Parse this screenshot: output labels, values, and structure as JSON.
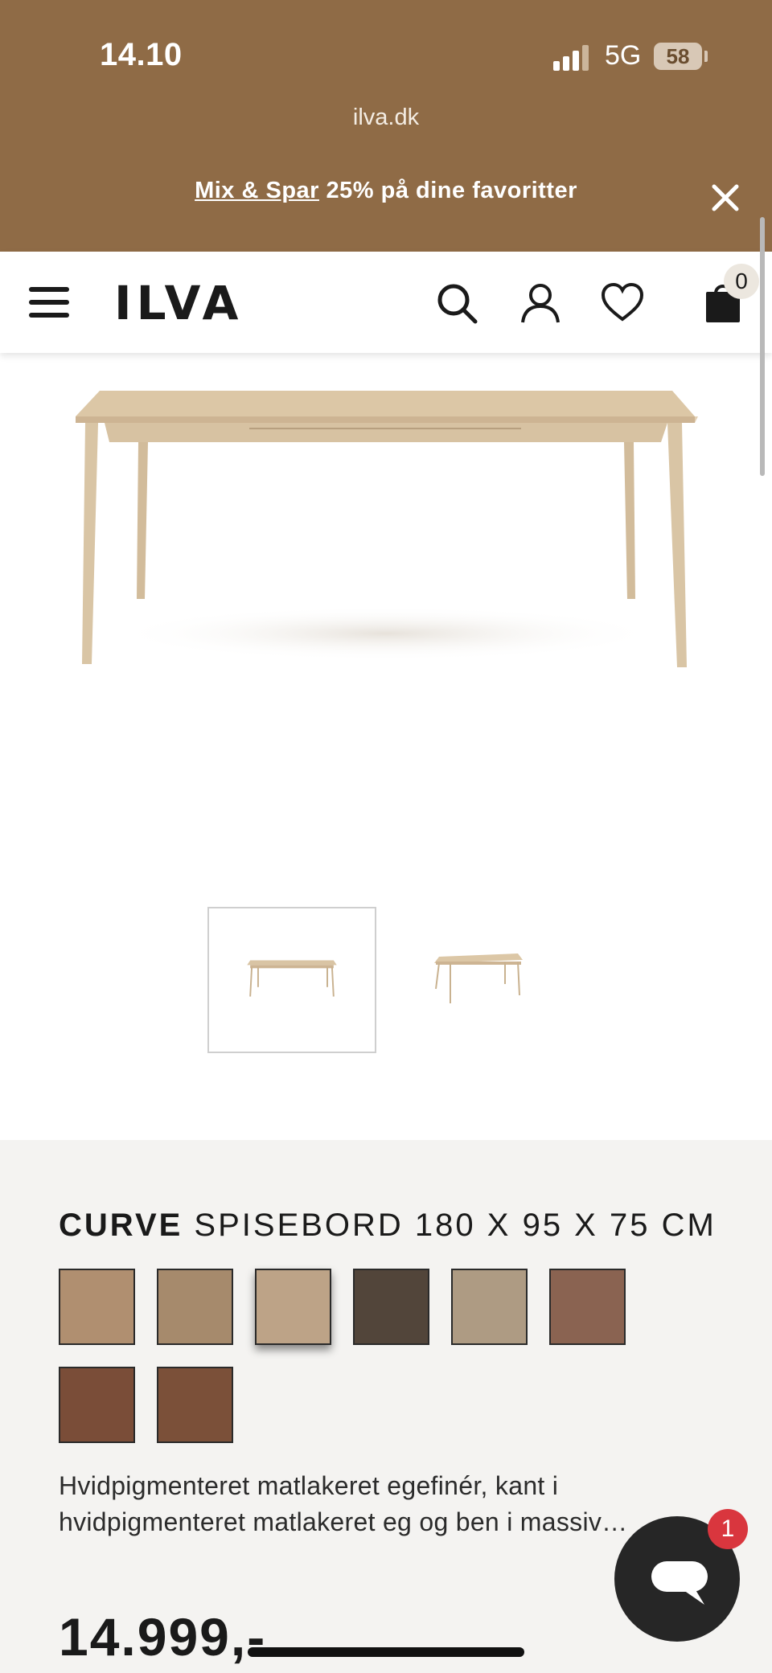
{
  "status_bar": {
    "time": "14.10",
    "network": "5G",
    "battery": "58"
  },
  "browser": {
    "url": "ilva.dk"
  },
  "promo": {
    "link_text": "Mix & Spar",
    "text": " 25% på dine favoritter"
  },
  "header": {
    "logo": "ILVA",
    "cart_count": "0"
  },
  "product": {
    "brand": "CURVE",
    "name": " SPISEBORD 180 X 95 X 75 CM",
    "description": "Hvidpigmenteret matlakeret egefinér, kant i hvidpigmenteret matlakeret eg og ben i massiv…",
    "price": "14.999,-",
    "swatches": [
      {
        "color": "#b08f70"
      },
      {
        "color": "#a68a6c"
      },
      {
        "color": "#bda387",
        "selected": true
      },
      {
        "color": "#52453a"
      },
      {
        "color": "#ae9b83"
      },
      {
        "color": "#8a6351"
      },
      {
        "color": "#7a4d38"
      },
      {
        "color": "#7b5039"
      }
    ]
  },
  "chat": {
    "unread": "1"
  },
  "colors": {
    "brand_bar": "#8f6b46",
    "info_bg": "#f4f3f1"
  }
}
